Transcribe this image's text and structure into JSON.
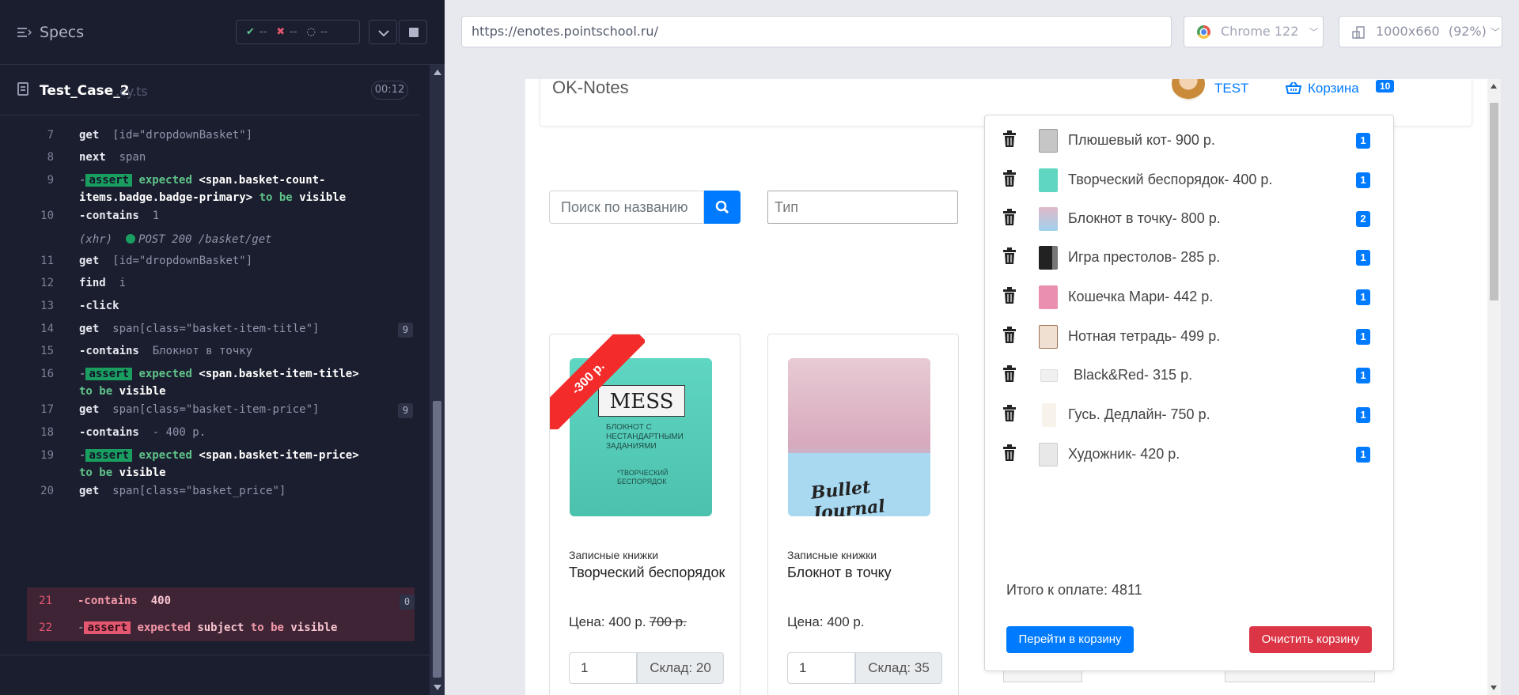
{
  "runner": {
    "specs_label": "Specs",
    "stats": {
      "passed": "--",
      "failed": "--",
      "pending": "--"
    },
    "spec_name": "Test_Case_2",
    "spec_ext": ".cy.ts",
    "spec_time": "00:12",
    "commands": [
      {
        "num": "7",
        "name": "get",
        "arg": "[id=\"dropdownBasket\"]"
      },
      {
        "num": "8",
        "name": "next",
        "arg": "span"
      },
      {
        "num": "9",
        "badge": "assert",
        "text1": "expected",
        "text2": "<span.basket-count-",
        "text3": "items.badge.badge-primary>",
        "text4": "to be",
        "text5": "visible"
      },
      {
        "num": "10",
        "name": "-contains",
        "arg": "1"
      },
      {
        "xhr_label": "(xhr)",
        "xhr_text": "POST 200 /basket/get"
      },
      {
        "num": "11",
        "name": "get",
        "arg": "[id=\"dropdownBasket\"]"
      },
      {
        "num": "12",
        "name": "find",
        "arg": "i"
      },
      {
        "num": "13",
        "name": "-click",
        "arg": ""
      },
      {
        "num": "14",
        "name": "get",
        "arg": "span[class=\"basket-item-title\"]",
        "count": "9"
      },
      {
        "num": "15",
        "name": "-contains",
        "arg": "Блокнот в точку"
      },
      {
        "num": "16",
        "badge": "assert",
        "text1": "expected",
        "text2": "<span.basket-item-title>",
        "text4": "to be",
        "text5": "visible"
      },
      {
        "num": "17",
        "name": "get",
        "arg": "span[class=\"basket-item-price\"]",
        "count": "9"
      },
      {
        "num": "18",
        "name": "-contains",
        "arg": "- 400 р."
      },
      {
        "num": "19",
        "badge": "assert",
        "text1": "expected",
        "text2": "<span.basket-item-price>",
        "text4": "to be",
        "text5": "visible"
      },
      {
        "num": "20",
        "name": "get",
        "arg": "span[class=\"basket_price\"]"
      },
      {
        "num": "21",
        "name": "-contains",
        "arg": "400",
        "count": "0"
      },
      {
        "num": "22",
        "badge": "assert",
        "text1": "expected",
        "text2": "subject",
        "text4": "to be",
        "text5": "visible"
      }
    ]
  },
  "browser": {
    "url": "https://enotes.pointschool.ru/",
    "browser_name": "Chrome 122",
    "viewport": "1000x660",
    "zoom": "(92%)"
  },
  "app": {
    "brand": "OK-Notes",
    "user": "TEST",
    "basket_label": "Корзина",
    "basket_count": "10",
    "search_placeholder": "Поиск по названию",
    "type_placeholder": "Тип",
    "cards": [
      {
        "ribbon": "-300 р.",
        "category": "Записные книжки",
        "title": "Творческий беспорядок",
        "price": "Цена: 400 р.",
        "old_price": "700 р.",
        "qty": "1",
        "stock": "Склад: 20"
      },
      {
        "category": "Записные книжки",
        "title": "Блокнот в точку",
        "price": "Цена: 400 р.",
        "qty": "1",
        "stock": "Склад: 35"
      }
    ],
    "basket_items": [
      {
        "title": "Плюшевый кот- 900 р.",
        "count": "1"
      },
      {
        "title": "Творческий беспорядок- 400 р.",
        "count": "1"
      },
      {
        "title": "Блокнот в точку- 800 р.",
        "count": "2"
      },
      {
        "title": "Игра престолов- 285 р.",
        "count": "1"
      },
      {
        "title": "Кошечка Мари- 442 р.",
        "count": "1"
      },
      {
        "title": "Нотная тетрадь- 499 р.",
        "count": "1"
      },
      {
        "title": "Black&Red- 315 р.",
        "count": "1"
      },
      {
        "title": "Гусь. Дедлайн- 750 р.",
        "count": "1"
      },
      {
        "title": "Художник- 420 р.",
        "count": "1"
      }
    ],
    "total": "Итого к оплате: 4811",
    "go_to_basket": "Перейти в корзину",
    "clear_basket": "Очистить корзину"
  }
}
